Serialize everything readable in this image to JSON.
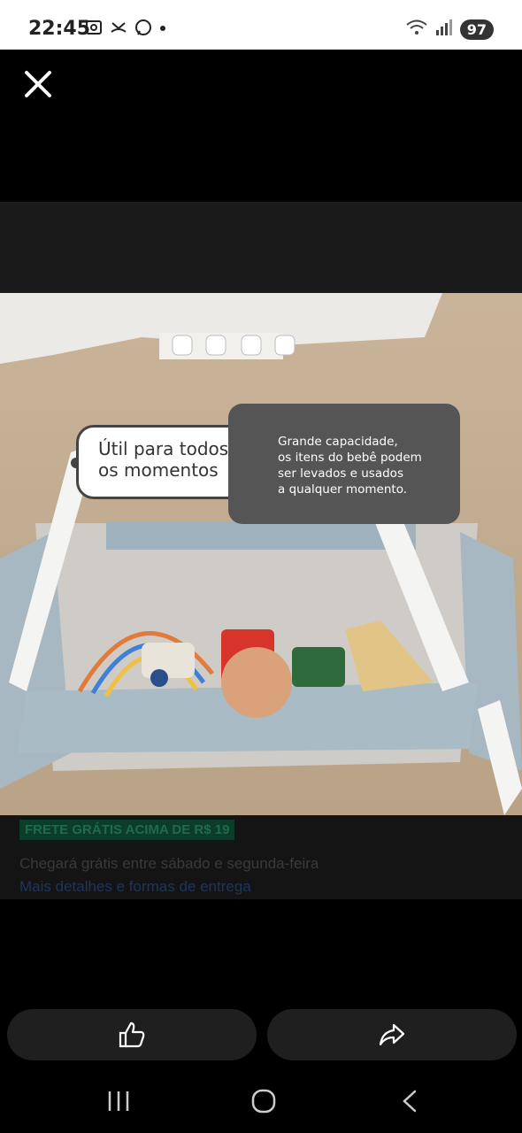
{
  "status_bar": {
    "time": "22:45",
    "battery": "97",
    "icons_left": [
      "screenshot-icon",
      "missed-call-icon",
      "whatsapp-icon",
      "notification-dot-icon"
    ],
    "icons_right": [
      "wifi-icon",
      "signal-icon"
    ]
  },
  "viewer": {
    "close_icon": "close-icon",
    "image": {
      "callout_title": "Útil para todos os momentos",
      "callout_title_line1": "Útil para todos",
      "callout_title_line2": "os momentos",
      "callout_desc_lines": [
        "Grande capacidade,",
        "os itens do bebê podem",
        "ser levados e usados",
        "a qualquer momento."
      ]
    },
    "background_text": {
      "badge": "FRETE GRÁTIS ACIMA DE R$ 19",
      "line1": "Chegará grátis entre sábado e segunda-feira",
      "line2": "Mais detalhes e formas de entrega"
    }
  },
  "actions": {
    "like_icon": "thumbs-up-icon",
    "share_icon": "share-icon"
  },
  "navbar": {
    "recents_icon": "recents-icon",
    "home_icon": "home-icon",
    "back_icon": "back-icon"
  }
}
